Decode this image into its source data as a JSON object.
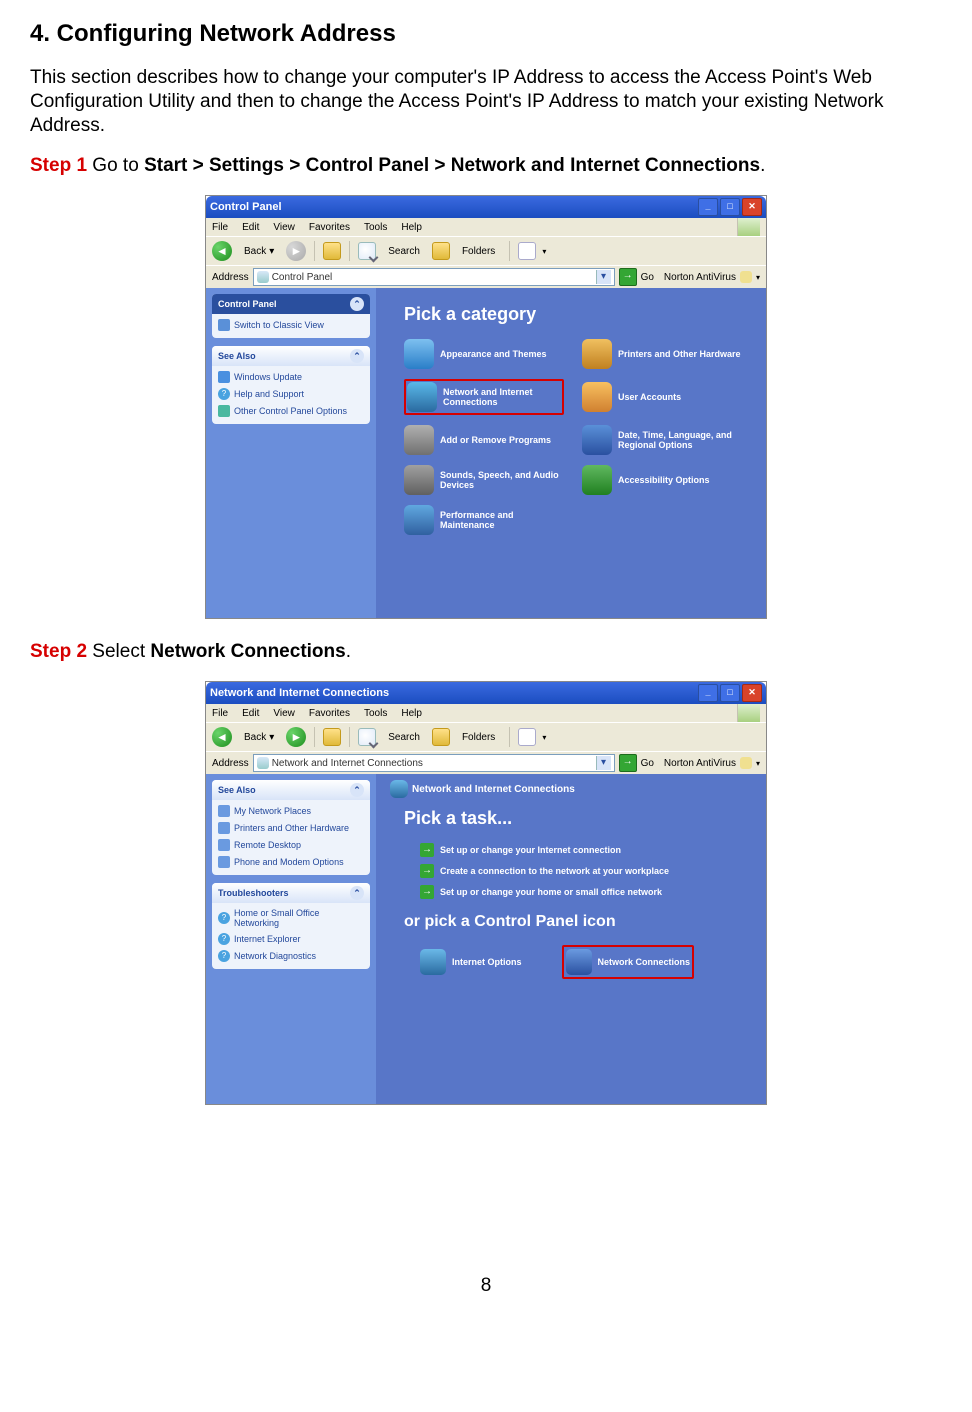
{
  "doc": {
    "heading": "4. Configuring Network Address",
    "intro": "This section describes how to change your computer's IP Address to access the Access Point's Web Configuration Utility and then to change the Access Point's IP Address to match your existing Network Address.",
    "step1_label": "Step 1",
    "step1_text": " Go to ",
    "step1_bold": "Start > Settings > Control Panel > Network and Internet Connections",
    "step1_period": ".",
    "step2_label": "Step 2",
    "step2_text": " Select ",
    "step2_bold": "Network Connections",
    "step2_period": ".",
    "page_number": "8"
  },
  "shot1": {
    "title": "Control Panel",
    "menu": {
      "file": "File",
      "edit": "Edit",
      "view": "View",
      "fav": "Favorites",
      "tools": "Tools",
      "help": "Help"
    },
    "tb": {
      "back": "Back",
      "search": "Search",
      "folders": "Folders"
    },
    "addr": {
      "label": "Address",
      "value": "Control Panel",
      "go": "Go",
      "nav": "Norton AntiVirus"
    },
    "panel_cp_title": "Control Panel",
    "panel_cp_item": "Switch to Classic View",
    "panel_see_title": "See Also",
    "see_items": [
      "Windows Update",
      "Help and Support",
      "Other Control Panel Options"
    ],
    "pick": "Pick a category",
    "cats": [
      {
        "label": "Appearance and Themes",
        "color": "linear-gradient(#7dc0f0,#2a7ec8)"
      },
      {
        "label": "Printers and Other Hardware",
        "color": "linear-gradient(#f0c060,#c08020)"
      },
      {
        "label": "Network and Internet Connections",
        "color": "linear-gradient(#5ab8e8,#2a6aa0)",
        "hl": true
      },
      {
        "label": "User Accounts",
        "color": "linear-gradient(#f8c060,#d08030)"
      },
      {
        "label": "Add or Remove Programs",
        "color": "linear-gradient(#b0b0b0,#707070)"
      },
      {
        "label": "Date, Time, Language, and Regional Options",
        "color": "linear-gradient(#5a90d8,#2a50a0)"
      },
      {
        "label": "Sounds, Speech, and Audio Devices",
        "color": "linear-gradient(#a0a0a0,#606060)"
      },
      {
        "label": "Accessibility Options",
        "color": "linear-gradient(#60b860,#208020)"
      },
      {
        "label": "Performance and Maintenance",
        "color": "linear-gradient(#60a8e0,#3060a0)"
      }
    ]
  },
  "shot2": {
    "title": "Network and Internet Connections",
    "menu": {
      "file": "File",
      "edit": "Edit",
      "view": "View",
      "fav": "Favorites",
      "tools": "Tools",
      "help": "Help"
    },
    "tb": {
      "back": "Back",
      "search": "Search",
      "folders": "Folders"
    },
    "addr": {
      "label": "Address",
      "value": "Network and Internet Connections",
      "go": "Go",
      "nav": "Norton AntiVirus"
    },
    "panel_see_title": "See Also",
    "see_items": [
      "My Network Places",
      "Printers and Other Hardware",
      "Remote Desktop",
      "Phone and Modem Options"
    ],
    "panel_tr_title": "Troubleshooters",
    "tr_items": [
      "Home or Small Office Networking",
      "Internet Explorer",
      "Network Diagnostics"
    ],
    "crumb": "Network and Internet Connections",
    "pick_task": "Pick a task...",
    "tasks": [
      "Set up or change your Internet connection",
      "Create a connection to the network at your workplace",
      "Set up or change your home or small office network"
    ],
    "or_heading": "or pick a Control Panel icon",
    "cpicons": [
      {
        "label": "Internet Options",
        "color": "linear-gradient(#6ab8e8,#2a6aa0)"
      },
      {
        "label": "Network Connections",
        "color": "linear-gradient(#6a9ae0,#2a50a0)",
        "hl": true
      }
    ]
  }
}
